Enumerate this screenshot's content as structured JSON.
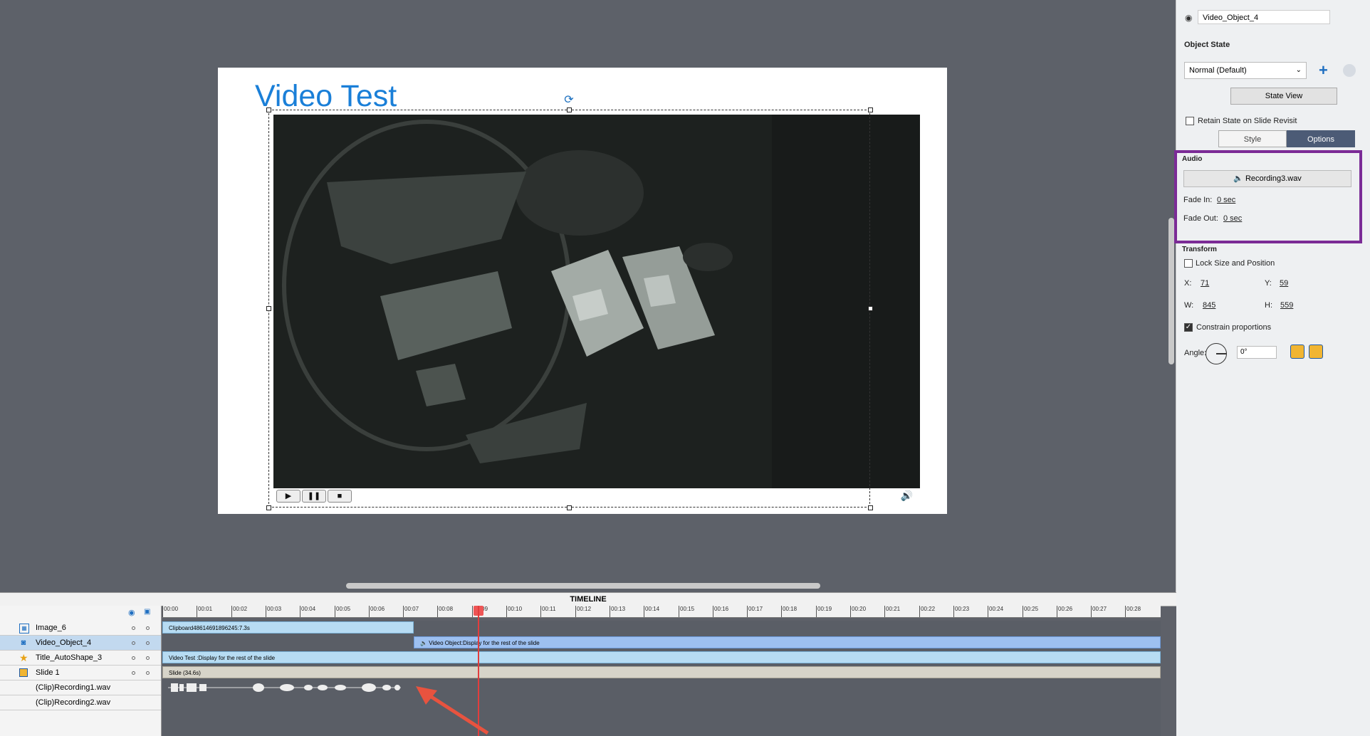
{
  "slide": {
    "title": "Video Test"
  },
  "player": {
    "play_icon": "play-icon",
    "pause_icon": "pause-icon",
    "stop_icon": "stop-icon",
    "volume_icon": "volume-icon"
  },
  "properties": {
    "object_name": "Video_Object_4",
    "object_state_heading": "Object State",
    "state_select_value": "Normal (Default)",
    "state_view_label": "State View",
    "retain_state_label": "Retain State on Slide Revisit",
    "tabs": [
      {
        "label": "Style",
        "active": false
      },
      {
        "label": "Options",
        "active": true
      }
    ],
    "audio": {
      "heading": "Audio",
      "file": "Recording3.wav",
      "fade_in_label": "Fade In:",
      "fade_in_value": "0 sec",
      "fade_out_label": "Fade Out:",
      "fade_out_value": "0 sec"
    },
    "transform": {
      "heading": "Transform",
      "lock_label": "Lock Size and Position",
      "x_label": "X:",
      "x_value": "71",
      "y_label": "Y:",
      "y_value": "59",
      "w_label": "W:",
      "w_value": "845",
      "h_label": "H:",
      "h_value": "559",
      "constrain_label": "Constrain proportions",
      "constrain_checked": true,
      "angle_label": "Angle:",
      "angle_value": "0°"
    }
  },
  "timeline": {
    "title": "TIMELINE",
    "ticks": [
      "00:00",
      "00:01",
      "00:02",
      "00:03",
      "00:04",
      "00:05",
      "00:06",
      "00:07",
      "00:08",
      "00:09",
      "00:10",
      "00:11",
      "00:12",
      "00:13",
      "00:14",
      "00:15",
      "00:16",
      "00:17",
      "00:18",
      "00:19",
      "00:20",
      "00:21",
      "00:22",
      "00:23",
      "00:24",
      "00:25",
      "00:26",
      "00:27",
      "00:28"
    ],
    "layers": [
      {
        "name": "Image_6",
        "icon": "image-icon"
      },
      {
        "name": "Video_Object_4",
        "icon": "video-icon",
        "selected": true
      },
      {
        "name": "Title_AutoShape_3",
        "icon": "star-icon"
      },
      {
        "name": "Slide 1",
        "icon": "slide-icon"
      },
      {
        "name": "(Clip)Recording1.wav",
        "icon": ""
      },
      {
        "name": "(Clip)Recording2.wav",
        "icon": ""
      }
    ],
    "bars": {
      "image": "Clipboard48614691896245:7.3s",
      "video": "Video Object:Display for the rest of the slide",
      "title": "Video Test :Display for the rest of the slide",
      "slide": "Slide (34.6s)"
    },
    "playhead_time": "00:09"
  },
  "colors": {
    "accent": "#1a7fd8",
    "highlight_box": "#7b2b96",
    "active_tab": "#4c5b76",
    "playhead": "#e23d3d",
    "annotation_arrow": "#e8533f"
  }
}
